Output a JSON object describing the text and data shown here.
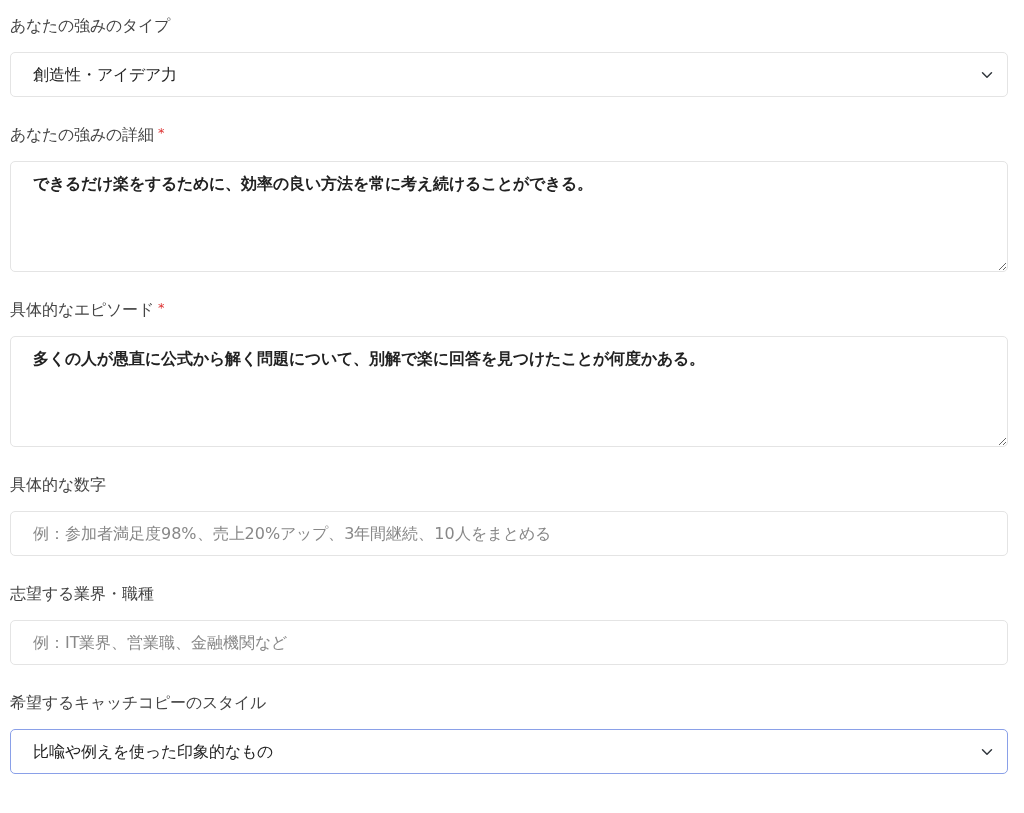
{
  "fields": [
    {
      "kind": "select",
      "label": "あなたの強みのタイプ",
      "focused": false,
      "value": "創造性・アイデア力"
    },
    {
      "kind": "textarea",
      "label": "あなたの強みの詳細",
      "required_mark": "*",
      "focused": false,
      "value": "できるだけ楽をするために、効率の良い方法を常に考え続けることができる。"
    },
    {
      "kind": "textarea",
      "label": "具体的なエピソード",
      "required_mark": "*",
      "focused": false,
      "value": "多くの人が愚直に公式から解く問題について、別解で楽に回答を見つけたことが何度かある。"
    },
    {
      "kind": "input",
      "label": "具体的な数字",
      "focused": false,
      "placeholder": "例：参加者満足度98%、売上20%アップ、3年間継続、10人をまとめる"
    },
    {
      "kind": "input",
      "label": "志望する業界・職種",
      "focused": false,
      "placeholder": "例：IT業界、営業職、金融機関など"
    },
    {
      "kind": "select",
      "label": "希望するキャッチコピーのスタイル",
      "focused": true,
      "value": "比喩や例えを使った印象的なもの"
    }
  ]
}
